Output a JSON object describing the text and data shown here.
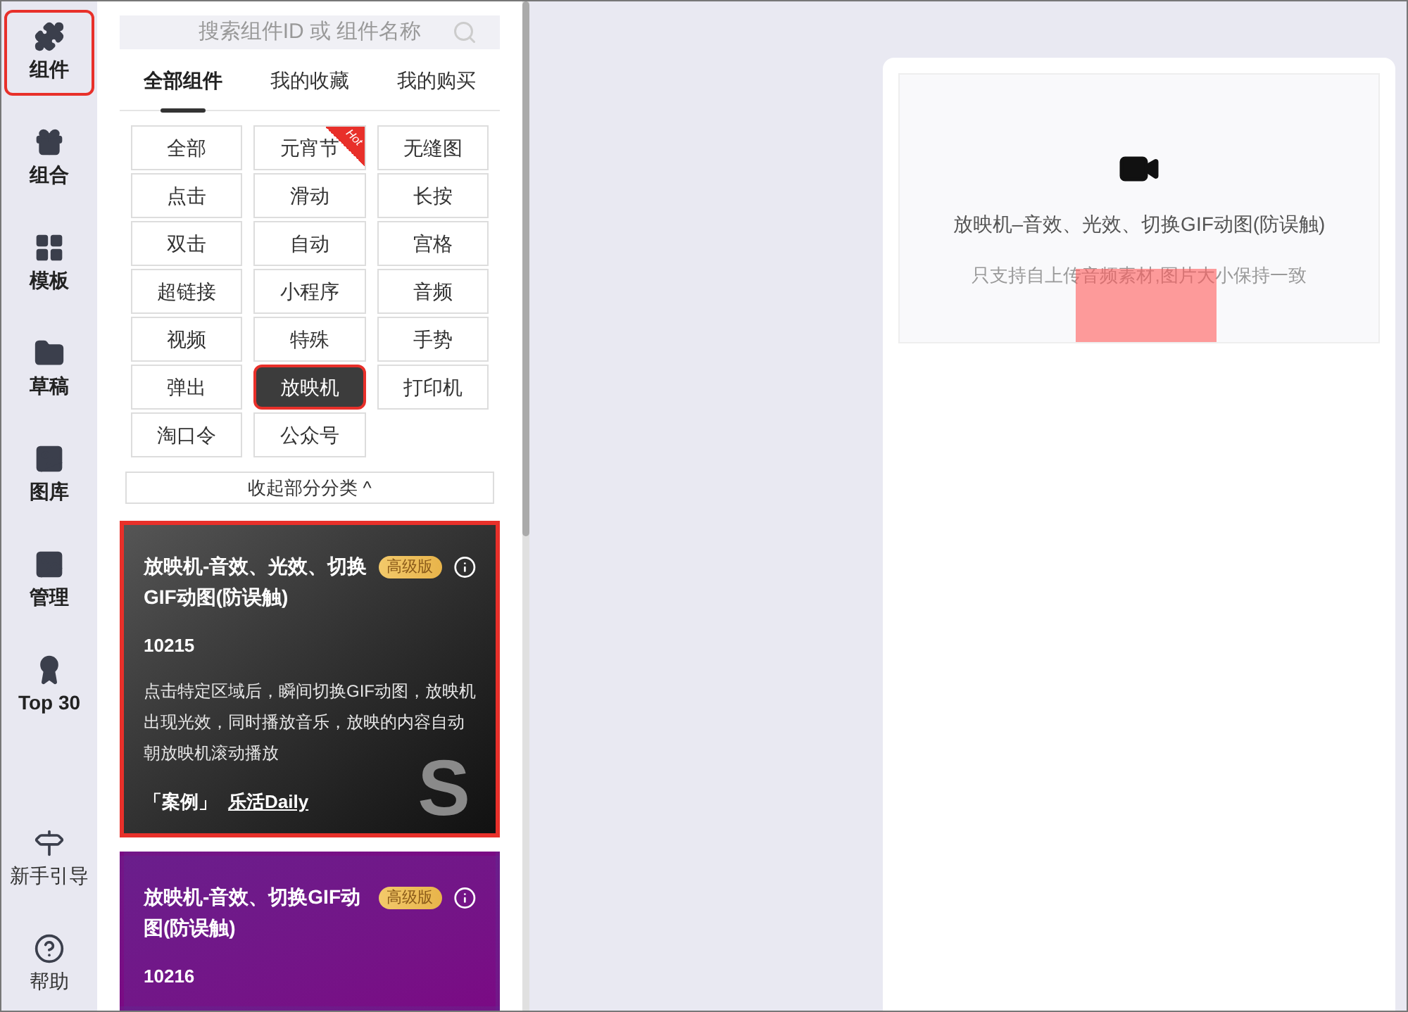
{
  "nav": [
    {
      "label": "组件",
      "selected": true
    },
    {
      "label": "组合",
      "selected": false
    },
    {
      "label": "模板",
      "selected": false
    },
    {
      "label": "草稿",
      "selected": false
    },
    {
      "label": "图库",
      "selected": false
    },
    {
      "label": "管理",
      "selected": false
    },
    {
      "label": "Top 30",
      "selected": false
    }
  ],
  "nav_bottom": [
    {
      "label": "新手引导"
    },
    {
      "label": "帮助"
    }
  ],
  "search": {
    "placeholder": "搜索组件ID 或 组件名称"
  },
  "tabs": [
    {
      "label": "全部组件",
      "selected": true
    },
    {
      "label": "我的收藏",
      "selected": false
    },
    {
      "label": "我的购买",
      "selected": false
    }
  ],
  "categories": [
    {
      "label": "全部",
      "selected": false
    },
    {
      "label": "元宵节",
      "selected": false,
      "badge": "Hot"
    },
    {
      "label": "无缝图",
      "selected": false
    },
    {
      "label": "点击",
      "selected": false
    },
    {
      "label": "滑动",
      "selected": false
    },
    {
      "label": "长按",
      "selected": false
    },
    {
      "label": "双击",
      "selected": false
    },
    {
      "label": "自动",
      "selected": false
    },
    {
      "label": "宫格",
      "selected": false
    },
    {
      "label": "超链接",
      "selected": false
    },
    {
      "label": "小程序",
      "selected": false
    },
    {
      "label": "音频",
      "selected": false
    },
    {
      "label": "视频",
      "selected": false
    },
    {
      "label": "特殊",
      "selected": false
    },
    {
      "label": "手势",
      "selected": false
    },
    {
      "label": "弹出",
      "selected": false
    },
    {
      "label": "放映机",
      "selected": true
    },
    {
      "label": "打印机",
      "selected": false
    },
    {
      "label": "淘口令",
      "selected": false
    },
    {
      "label": "公众号",
      "selected": false
    }
  ],
  "collapse_button": "收起部分分类 ^",
  "cards": [
    {
      "title": "放映机-音效、光效、切换GIF动图(防误触)",
      "badge": "高级版",
      "id": "10215",
      "description": "点击特定区域后，瞬间切换GIF动图，放映机出现光效，同时播放音乐，放映的内容自动朝放映机滚动播放",
      "case_label": "「案例」",
      "case_link": "乐活Daily",
      "watermark_letter": "S",
      "selected": true
    },
    {
      "title": "放映机-音效、切换GIF动图(防误触)",
      "badge": "高级版",
      "id": "10216",
      "selected": false
    }
  ],
  "preview": {
    "title": "放映机–音效、光效、切换GIF动图(防误触)",
    "note": "只支持自上传音频素材,图片大小保持一致"
  }
}
